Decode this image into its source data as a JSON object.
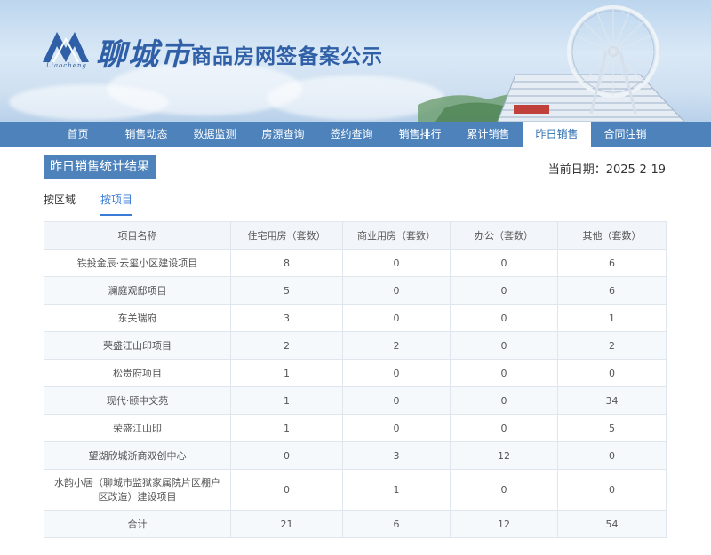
{
  "header": {
    "logo_sub": "Liaocheng",
    "city": "聊城市",
    "title": "商品房网签备案公示"
  },
  "nav": {
    "items": [
      {
        "label": "首页"
      },
      {
        "label": "销售动态"
      },
      {
        "label": "数据监测"
      },
      {
        "label": "房源查询"
      },
      {
        "label": "签约查询"
      },
      {
        "label": "销售排行"
      },
      {
        "label": "累计销售"
      },
      {
        "label": "昨日销售",
        "active": true
      },
      {
        "label": "合同注销"
      }
    ]
  },
  "main": {
    "result_title": "昨日销售统计结果",
    "date_label": "当前日期：",
    "date_value": "2025-2-19",
    "tabs": [
      {
        "label": "按区域"
      },
      {
        "label": "按项目",
        "active": true
      }
    ]
  },
  "table": {
    "headers": [
      "项目名称",
      "住宅用房（套数）",
      "商业用房（套数）",
      "办公（套数）",
      "其他（套数）"
    ],
    "rows": [
      [
        "铁投金辰·云玺小区建设项目",
        "8",
        "0",
        "0",
        "6"
      ],
      [
        "澜庭观邸项目",
        "5",
        "0",
        "0",
        "6"
      ],
      [
        "东关瑞府",
        "3",
        "0",
        "0",
        "1"
      ],
      [
        "荣盛江山印项目",
        "2",
        "2",
        "0",
        "2"
      ],
      [
        "松贵府项目",
        "1",
        "0",
        "0",
        "0"
      ],
      [
        "现代·颐中文苑",
        "1",
        "0",
        "0",
        "34"
      ],
      [
        "荣盛江山印",
        "1",
        "0",
        "0",
        "5"
      ],
      [
        "望湖欣城浙商双创中心",
        "0",
        "3",
        "12",
        "0"
      ],
      [
        "水韵小居（聊城市监狱家属院片区棚户区改造）建设项目",
        "0",
        "1",
        "0",
        "0"
      ],
      [
        "合计",
        "21",
        "6",
        "12",
        "54"
      ]
    ]
  },
  "colors": {
    "nav_bg": "#4d82bb",
    "accent": "#3a7bd5",
    "title_text": "#2f5fa6"
  }
}
